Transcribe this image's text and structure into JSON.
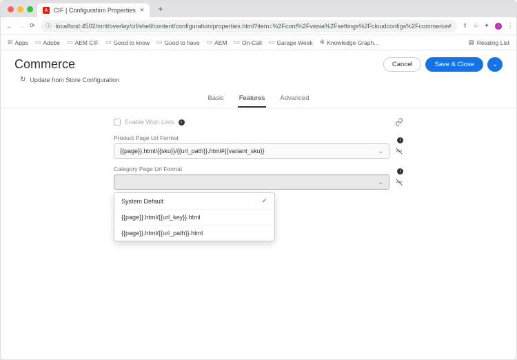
{
  "browser": {
    "tab_title": "CIF | Configuration Properties",
    "favicon_letter": "A",
    "url": "localhost:4502/mnt/overlay/cif/shell/content/configuration/properties.html?item=%2Fconf%2Fvenia%2Fsettings%2Fcloudconfigs%2Fcommerce#",
    "bookmarks": [
      "Apps",
      "Adobe",
      "AEM CIF",
      "Good to know",
      "Good to have",
      "AEM",
      "On-Call",
      "Garage Week",
      "Knowledge Graph..."
    ],
    "reading_list": "Reading List"
  },
  "header": {
    "title": "Commerce",
    "cancel": "Cancel",
    "save_close": "Save & Close"
  },
  "update_row": "Update from Store Configuration",
  "tabs": {
    "basic": "Basic",
    "features": "Features",
    "advanced": "Advanced"
  },
  "form": {
    "wishlist_label": "Enable Wish Lists",
    "product_label": "Product Page Url Format",
    "product_value": "{{page}}.html/{{sku}}/{{url_path}}.html#{{variant_sku}}",
    "category_label": "Category Page Url Format",
    "category_value": ""
  },
  "dropdown": {
    "opt0": "System Default",
    "opt1": "{{page}}.html/{{url_key}}.html",
    "opt2": "{{page}}.html/{{url_path}}.html"
  }
}
